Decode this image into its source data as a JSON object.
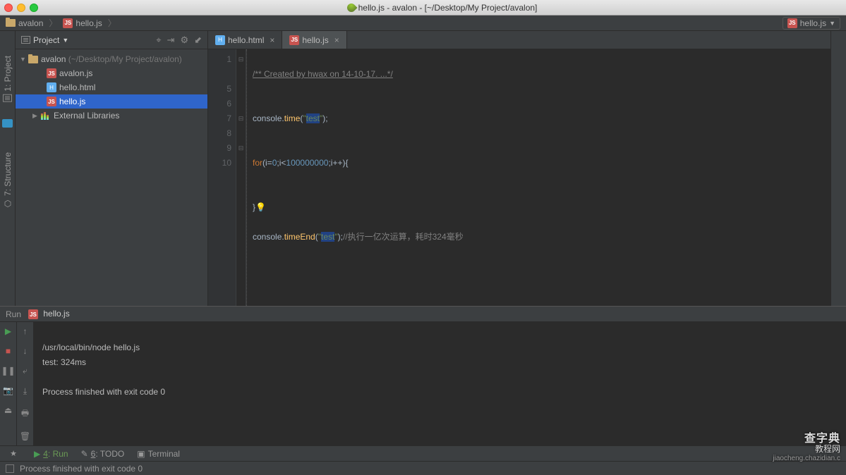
{
  "titlebar": "hello.js - avalon - [~/Desktop/My Project/avalon]",
  "breadcrumb": {
    "project": "avalon",
    "file": "hello.js",
    "dropdown": "hello.js"
  },
  "project_panel": {
    "title": "Project",
    "root": "avalon",
    "root_path": "(~/Desktop/My Project/avalon)",
    "files": [
      "avalon.js",
      "hello.html",
      "hello.js"
    ],
    "external": "External Libraries"
  },
  "tabs": [
    {
      "name": "hello.html",
      "type": "html"
    },
    {
      "name": "hello.js",
      "type": "js",
      "active": true
    }
  ],
  "code": {
    "line_numbers": [
      "1",
      "",
      "5",
      "6",
      "7",
      "8",
      "9",
      "10"
    ],
    "l1": "/** Created by hwax on 14-10-17. ...*/",
    "l5_a": "console.",
    "l5_b": "time",
    "l5_c": "(",
    "l5_d": "\"",
    "l5_e": "test",
    "l5_f": "\"",
    "l5_g": ");",
    "l6": "",
    "l7_for": "for",
    "l7_a": "(i=",
    "l7_0": "0",
    "l7_b": ";i<",
    "l7_n": "100000000",
    "l7_c": ";i++){",
    "l8": "",
    "l9": "}",
    "l10_a": "console.",
    "l10_b": "timeEnd",
    "l10_c": "(",
    "l10_d": "\"",
    "l10_e": "test",
    "l10_f": "\"",
    "l10_g": ");",
    "l10_comment": "//执行一亿次运算，耗时324毫秒"
  },
  "run": {
    "tab_label": "Run",
    "file": "hello.js",
    "out1": "/usr/local/bin/node hello.js",
    "out2": "test: 324ms",
    "out3": "",
    "out4": "Process finished with exit code 0",
    "out5": ""
  },
  "bottom_tabs": {
    "run": "4: Run",
    "todo": "6: TODO",
    "terminal": "Terminal"
  },
  "statusbar": "Process finished with exit code 0",
  "left_rail": {
    "project": "1: Project",
    "struct": "7: Structure",
    "fav": "2: Favorites"
  },
  "watermark": {
    "big": "查字典",
    "mid": "教程网",
    "small": "jiaocheng.chazidian.c"
  }
}
